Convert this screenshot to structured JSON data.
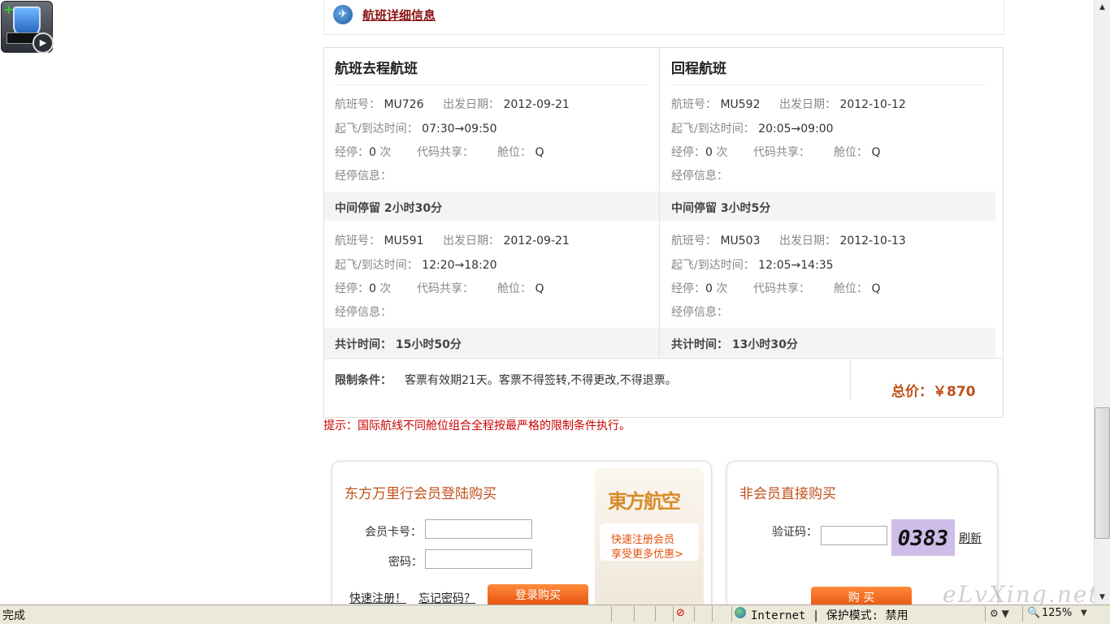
{
  "header": {
    "title": "航班详细信息"
  },
  "outbound": {
    "title": "航班去程航班",
    "leg1": {
      "flight_label": "航班号：",
      "flight_no": "MU726",
      "date_label": "出发日期：",
      "date": "2012-09-21",
      "time_label": "起飞/到达时间：",
      "time": "07:30→09:50",
      "stops_label": "经停：",
      "stops": "0",
      "stops_unit": "次",
      "codeshare_label": "代码共享：",
      "cabin_label": "舱位：",
      "cabin": "Q",
      "stopinfo_label": "经停信息："
    },
    "layover_label": "中间停留",
    "layover": "2小时30分",
    "leg2": {
      "flight_label": "航班号：",
      "flight_no": "MU591",
      "date_label": "出发日期：",
      "date": "2012-09-21",
      "time_label": "起飞/到达时间：",
      "time": "12:20→18:20",
      "stops_label": "经停：",
      "stops": "0",
      "stops_unit": "次",
      "codeshare_label": "代码共享：",
      "cabin_label": "舱位：",
      "cabin": "Q",
      "stopinfo_label": "经停信息："
    },
    "total_label": "共计时间：",
    "total": "15小时50分"
  },
  "return": {
    "title": "回程航班",
    "leg1": {
      "flight_label": "航班号：",
      "flight_no": "MU592",
      "date_label": "出发日期：",
      "date": "2012-10-12",
      "time_label": "起飞/到达时间：",
      "time": "20:05→09:00",
      "stops_label": "经停：",
      "stops": "0",
      "stops_unit": "次",
      "codeshare_label": "代码共享：",
      "cabin_label": "舱位：",
      "cabin": "Q",
      "stopinfo_label": "经停信息："
    },
    "layover_label": "中间停留",
    "layover": "3小时5分",
    "leg2": {
      "flight_label": "航班号：",
      "flight_no": "MU503",
      "date_label": "出发日期：",
      "date": "2012-10-13",
      "time_label": "起飞/到达时间：",
      "time": "12:05→14:35",
      "stops_label": "经停：",
      "stops": "0",
      "stops_unit": "次",
      "codeshare_label": "代码共享：",
      "cabin_label": "舱位：",
      "cabin": "Q",
      "stopinfo_label": "经停信息："
    },
    "total_label": "共计时间：",
    "total": "13小时30分"
  },
  "restriction": {
    "label": "限制条件：",
    "text": "客票有效期21天。客票不得签转,不得更改,不得退票。"
  },
  "price": {
    "label": "总价：",
    "value": "￥870"
  },
  "tip": "提示：国际航线不同舱位组合全程按最严格的限制条件执行。",
  "member": {
    "title": "东方万里行会员登陆购买",
    "card_label": "会员卡号：",
    "password_label": "密码：",
    "register_link": "快速注册！",
    "forgot_link": "忘记密码？",
    "buy_button": "登录购买"
  },
  "ad": {
    "logo_text": "東方航空",
    "line1": "快速注册会员",
    "line2": "享受更多优惠>"
  },
  "nonmember": {
    "title": "非会员直接购买",
    "captcha_label": "验证码：",
    "captcha_code": "0383",
    "refresh_link": "刷新",
    "buy_button": "购 买"
  },
  "statusbar": {
    "status": "完成",
    "zone": "Internet | 保护模式: 禁用",
    "zoom": "125%"
  },
  "watermark": "eLvXing.net",
  "colors": {
    "price": "#c0511a",
    "tip": "#cc0000",
    "title_link": "#8b1212",
    "button": "#e4500e"
  },
  "icons": [
    "app-shield-video-icon",
    "plane-icon",
    "globe-icon",
    "security-icon",
    "zoom-icon"
  ]
}
